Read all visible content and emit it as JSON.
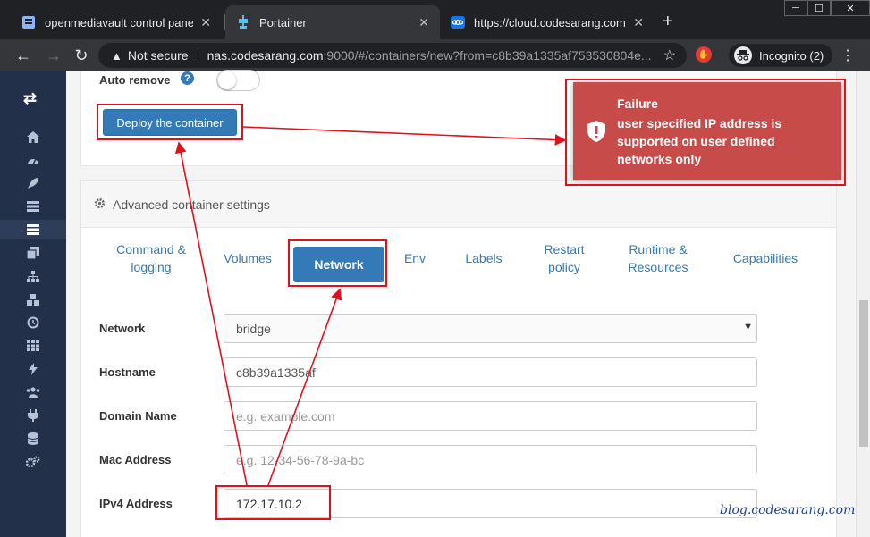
{
  "browser": {
    "tabs": [
      {
        "title": "openmediavault control panel - c",
        "favicon": "omv-icon",
        "active": false
      },
      {
        "title": "Portainer",
        "favicon": "portainer-icon",
        "active": true
      },
      {
        "title": "https://cloud.codesarang.com",
        "favicon": "nextcloud-icon",
        "active": false
      }
    ],
    "new_tab": "+",
    "security_label": "Not secure",
    "url_host": "nas.codesarang.com",
    "url_rest": ":9000/#/containers/new?from=c8b39a1335af753530804e...",
    "incognito_label": "Incognito (2)"
  },
  "sidebar": {
    "icons": [
      "swap-icon",
      "home-icon",
      "dashboard-icon",
      "rocket-icon",
      "list-icon",
      "server-icon",
      "copy-icon",
      "sitemap-icon",
      "cubes-icon",
      "history-icon",
      "grid-icon",
      "bolt-icon",
      "users-icon",
      "plug-icon",
      "database-icon",
      "cogs-icon"
    ],
    "active_index": 5
  },
  "form_top": {
    "auto_remove_label": "Auto remove",
    "help_glyph": "?",
    "auto_remove_enabled": false,
    "deploy_label": "Deploy the container"
  },
  "advanced": {
    "title": "Advanced container settings",
    "tabs": [
      {
        "label": "Command & logging"
      },
      {
        "label": "Volumes"
      },
      {
        "label": "Network"
      },
      {
        "label": "Env"
      },
      {
        "label": "Labels"
      },
      {
        "label": "Restart policy"
      },
      {
        "label": "Runtime & Resources"
      },
      {
        "label": "Capabilities"
      }
    ],
    "active_tab": "Network",
    "fields": {
      "network": {
        "label": "Network",
        "value": "bridge"
      },
      "hostname": {
        "label": "Hostname",
        "value": "c8b39a1335af"
      },
      "domain": {
        "label": "Domain Name",
        "placeholder": "e.g. example.com"
      },
      "mac": {
        "label": "Mac Address",
        "placeholder": "e.g. 12-34-56-78-9a-bc"
      },
      "ipv4": {
        "label": "IPv4 Address",
        "value": "172.17.10.2"
      }
    }
  },
  "toast": {
    "title": "Failure",
    "message": "user specified IP address is supported on user defined networks only",
    "color": "#c74b48"
  },
  "watermark": "blog.codesarang.com",
  "colors": {
    "primary": "#337ab7",
    "annotation": "#e0111b",
    "sidebar": "#23304a"
  }
}
